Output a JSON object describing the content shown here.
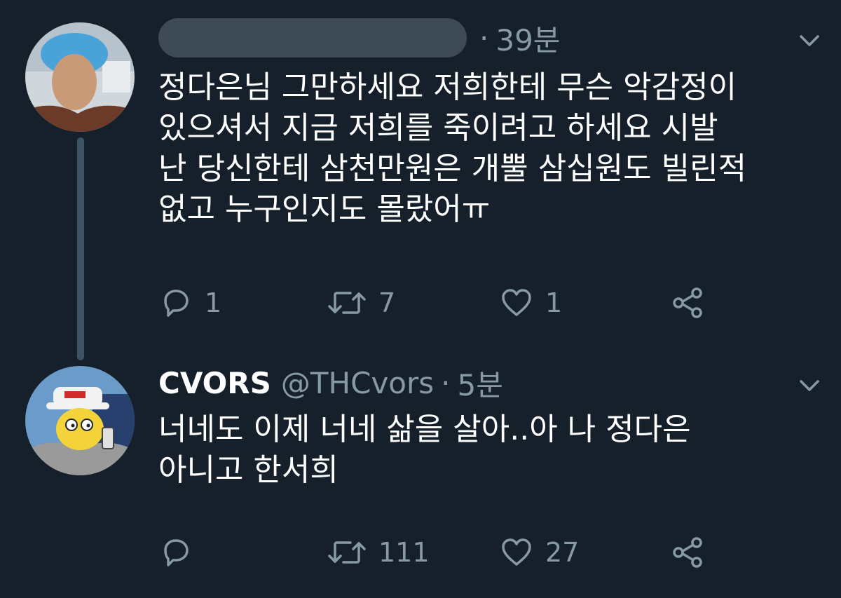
{
  "tweets": [
    {
      "time": "39분",
      "lines": [
        "정다은님 그만하세요 저희한테 무슨 악감정이",
        "있으셔서 지금 저희를 죽이려고 하세요 시발",
        "난 당신한테 삼천만원은 개뿔 삼십원도 빌린적",
        "없고 누구인지도 몰랐어ㅠ"
      ],
      "replies": "1",
      "retweets": "7",
      "likes": "1"
    },
    {
      "name": "CVORS",
      "handle": "@THCvors",
      "time": "5분",
      "lines": [
        "너네도 이제 너네 삶을 살아..아 나 정다은",
        "아니고 한서희"
      ],
      "replies": "",
      "retweets": "111",
      "likes": "27"
    }
  ],
  "colors": {
    "background": "#15202b",
    "secondary_text": "#8899a6",
    "thread_line": "#3d5466"
  },
  "icons": [
    "reply-icon",
    "retweet-icon",
    "like-icon",
    "share-icon",
    "chevron-down-icon"
  ]
}
